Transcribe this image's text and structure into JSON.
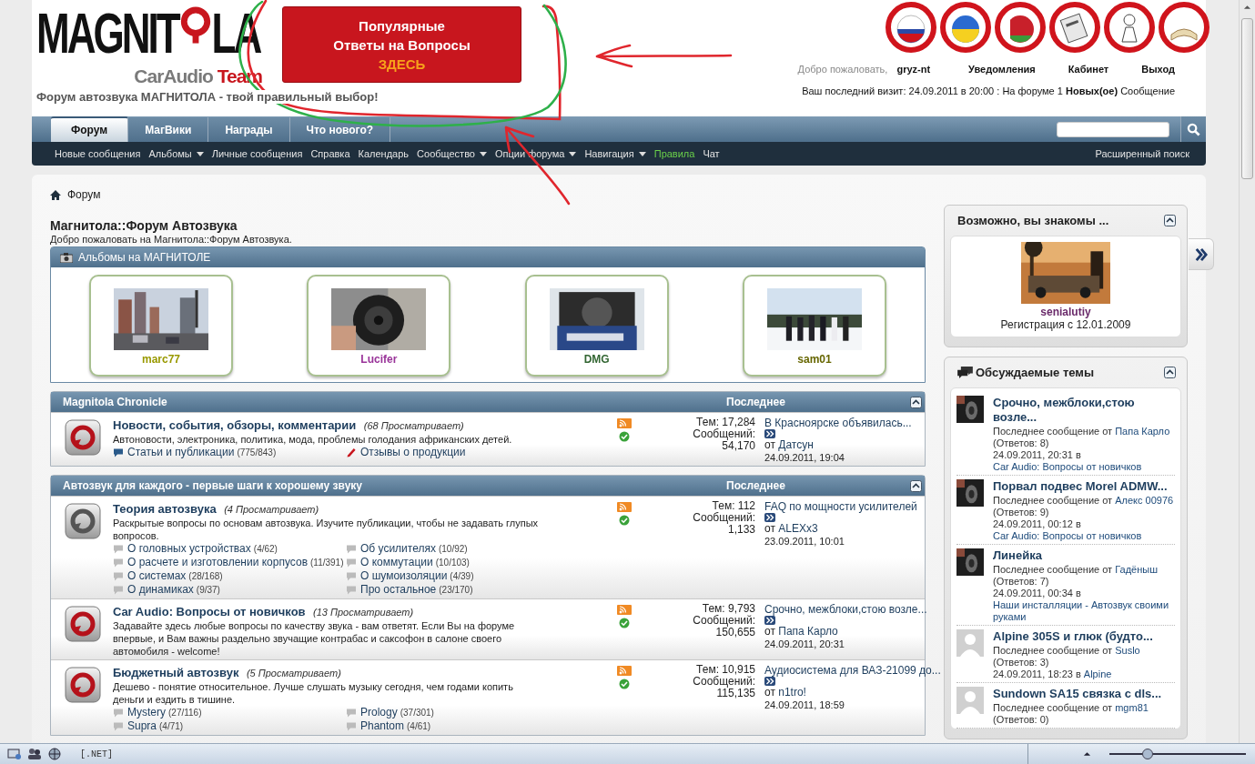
{
  "logo": {
    "left": "MAGNIT",
    "right": "LA",
    "sub_1": "CarAudio",
    "sub_2": "Team"
  },
  "banner": {
    "lines": [
      "Популярные",
      "Ответы на Вопросы"
    ],
    "highlight": "ЗДЕСЬ"
  },
  "tagline": "Форум автозвука МАГНИТОЛА - твой правильный выбор!",
  "user": {
    "welcome": "Добро пожаловать,",
    "name": "gryz-nt",
    "links": [
      "Уведомления",
      "Кабинет",
      "Выход"
    ]
  },
  "last_visit": "Ваш последний визит: 24.09.2011 в 20:00 : На форуме 1 **Новых(ое)** Сообщение",
  "tabs": [
    {
      "label": "Форум",
      "selected": true
    },
    {
      "label": "МагВики",
      "selected": false
    },
    {
      "label": "Награды",
      "selected": false
    },
    {
      "label": "Что нового?",
      "selected": false
    }
  ],
  "subnav": [
    {
      "label": "Новые сообщения",
      "kind": "link"
    },
    {
      "label": "Альбомы",
      "kind": "menu"
    },
    {
      "label": "Личные сообщения",
      "kind": "link"
    },
    {
      "label": "Справка",
      "kind": "link"
    },
    {
      "label": "Календарь",
      "kind": "link"
    },
    {
      "label": "Сообщество",
      "kind": "menu"
    },
    {
      "label": "Опции форума",
      "kind": "menu"
    },
    {
      "label": "Навигация",
      "kind": "menu"
    },
    {
      "label": "Правила",
      "kind": "highlight"
    },
    {
      "label": "Чат",
      "kind": "link"
    }
  ],
  "advanced_search": "Расширенный поиск",
  "breadcrumb": "Форум",
  "forum_title": "Магнитола::Форум Автозвука",
  "forum_welcome": "Добро пожаловать на Магнитола::Форум Автозвука.",
  "albums": {
    "title": "Альбомы на МАГНИТОЛЕ",
    "items": [
      {
        "user": "marc77",
        "color": "#999900"
      },
      {
        "user": "Lucifer",
        "color": "#993399"
      },
      {
        "user": "DMG",
        "color": "#336633"
      },
      {
        "user": "sam01",
        "color": "#666600"
      }
    ]
  },
  "categories": [
    {
      "title": "Magnitola Chronicle",
      "last_header": "Последнее",
      "forums": [
        {
          "title": "Новости, события, обзоры, комментарии",
          "viewers": "(68 Просматривает)",
          "description": "Автоновости, электроника, политика, мода, проблемы голодания африканских детей.",
          "new_posts": true,
          "subforums": [
            {
              "name": "Статьи и публикации",
              "count": "(775/843)",
              "kind": "bubble"
            },
            {
              "name": "Отзывы о продукции",
              "kind": "pencil"
            }
          ],
          "topics": "Тем: 17,284",
          "posts_label": "Сообщений:",
          "posts": "54,170",
          "last": {
            "title": "В Красноярске объявилась...",
            "by_label": "от",
            "by": "Датсун",
            "date": "24.09.2011, 19:04"
          }
        }
      ]
    },
    {
      "title": "Автозвук для каждого - первые шаги к хорошему звуку",
      "last_header": "Последнее",
      "forums": [
        {
          "title": "Теория автозвука",
          "viewers": "(4 Просматривает)",
          "description": "Раскрытые вопросы по основам автозвука. Изучите публикации, чтобы не задавать глупых вопросов.",
          "new_posts": false,
          "subforums": [
            {
              "name": "О головных устройствах",
              "count": "(4/62)",
              "kind": "bubble"
            },
            {
              "name": "Об усилителях",
              "count": "(10/92)",
              "kind": "bubble"
            },
            {
              "name": "О расчете и изготовлении корпусов",
              "count": "(11/391)",
              "kind": "bubble"
            },
            {
              "name": "О коммутации",
              "count": "(10/103)",
              "kind": "bubble"
            },
            {
              "name": "О системах",
              "count": "(28/168)",
              "kind": "bubble"
            },
            {
              "name": "О шумоизоляции",
              "count": "(4/39)",
              "kind": "bubble"
            },
            {
              "name": "О динамиках",
              "count": "(9/37)",
              "kind": "bubble"
            },
            {
              "name": "Про остальное",
              "count": "(23/170)",
              "kind": "bubble"
            }
          ],
          "topics": "Тем: 112",
          "posts_label": "Сообщений:",
          "posts": "1,133",
          "last": {
            "title": "FAQ по мощности усилителей",
            "by_label": "от",
            "by": "ALEXx3",
            "date": "23.09.2011, 10:01"
          }
        },
        {
          "title": "Car Audio: Вопросы от новичков",
          "viewers": "(13 Просматривает)",
          "description": "Задавайте здесь любые вопросы по качеству звука - вам ответят. Если Вы на форуме впервые, и Вам важны раздельно звучащие контрабас и саксофон в салоне своего автомобиля - welcome!",
          "new_posts": true,
          "topics": "Тем: 9,793",
          "posts_label": "Сообщений:",
          "posts": "150,655",
          "last": {
            "title": "Срочно, межблоки,стою возле...",
            "by_label": "от",
            "by": "Папа Карло",
            "date": "24.09.2011, 20:31"
          }
        },
        {
          "title": "Бюджетный автозвук",
          "viewers": "(5 Просматривает)",
          "description": "Дешево - понятие относительное. Лучше слушать музыку сегодня, чем годами копить деньги и ездить в тишине.",
          "new_posts": true,
          "subforums": [
            {
              "name": "Mystery",
              "count": "(27/116)",
              "kind": "bubble"
            },
            {
              "name": "Prology",
              "count": "(37/301)",
              "kind": "bubble"
            },
            {
              "name": "Supra",
              "count": "(4/71)",
              "kind": "bubble"
            },
            {
              "name": "Phantom",
              "count": "(4/61)",
              "kind": "bubble"
            }
          ],
          "topics": "Тем: 10,915",
          "posts_label": "Сообщений:",
          "posts": "115,135",
          "last": {
            "title": "Аудиосистема для ВАЗ-21099 до...",
            "by_label": "от",
            "by": "n1tro!",
            "date": "24.09.2011, 18:59"
          }
        }
      ]
    }
  ],
  "sidebar": {
    "known": {
      "title": "Возможно, вы знакомы ...",
      "user": "senialutiy",
      "registered": "Регистрация с 12.01.2009"
    },
    "discussed": {
      "title": "Обсуждаемые темы",
      "topics": [
        {
          "title": "Срочно, межблоки,стою возле...",
          "by_label": "Последнее сообщение от",
          "by": "Папа Карло",
          "replies": "(Ответов: 8)",
          "date": "24.09.2011, 20:31 в",
          "forum": "Car Audio: Вопросы от новичков"
        },
        {
          "title": "Порвал подвес Morel ADMW...",
          "by_label": "Последнее сообщение от",
          "by": "Алекс 00976",
          "replies": "(Ответов: 9)",
          "date": "24.09.2011, 00:12 в",
          "forum": "Car Audio: Вопросы от новичков"
        },
        {
          "title": "Линейка",
          "by_label": "Последнее сообщение от",
          "by": "Гадёныш",
          "replies": "(Ответов: 7)",
          "date": "24.09.2011, 00:34 в",
          "forum": "Наши инсталляции - Автозвук своими руками"
        },
        {
          "title": "Alpine 305S и глюк (будто...",
          "kind": "default",
          "by_label": "Последнее сообщение от",
          "by": "Suslo",
          "replies": "(Ответов: 3)",
          "date": "24.09.2011, 18:23 в",
          "forum": "Alpine"
        },
        {
          "title": "Sundown SA15 связка с dls...",
          "kind": "default",
          "by_label": "Последнее сообщение от",
          "by": "mgm81",
          "replies": "(Ответов: 0)"
        }
      ]
    }
  },
  "status_bar": {
    "text": "[.NET]",
    "zoom_slider": {
      "level": 0.28
    }
  }
}
